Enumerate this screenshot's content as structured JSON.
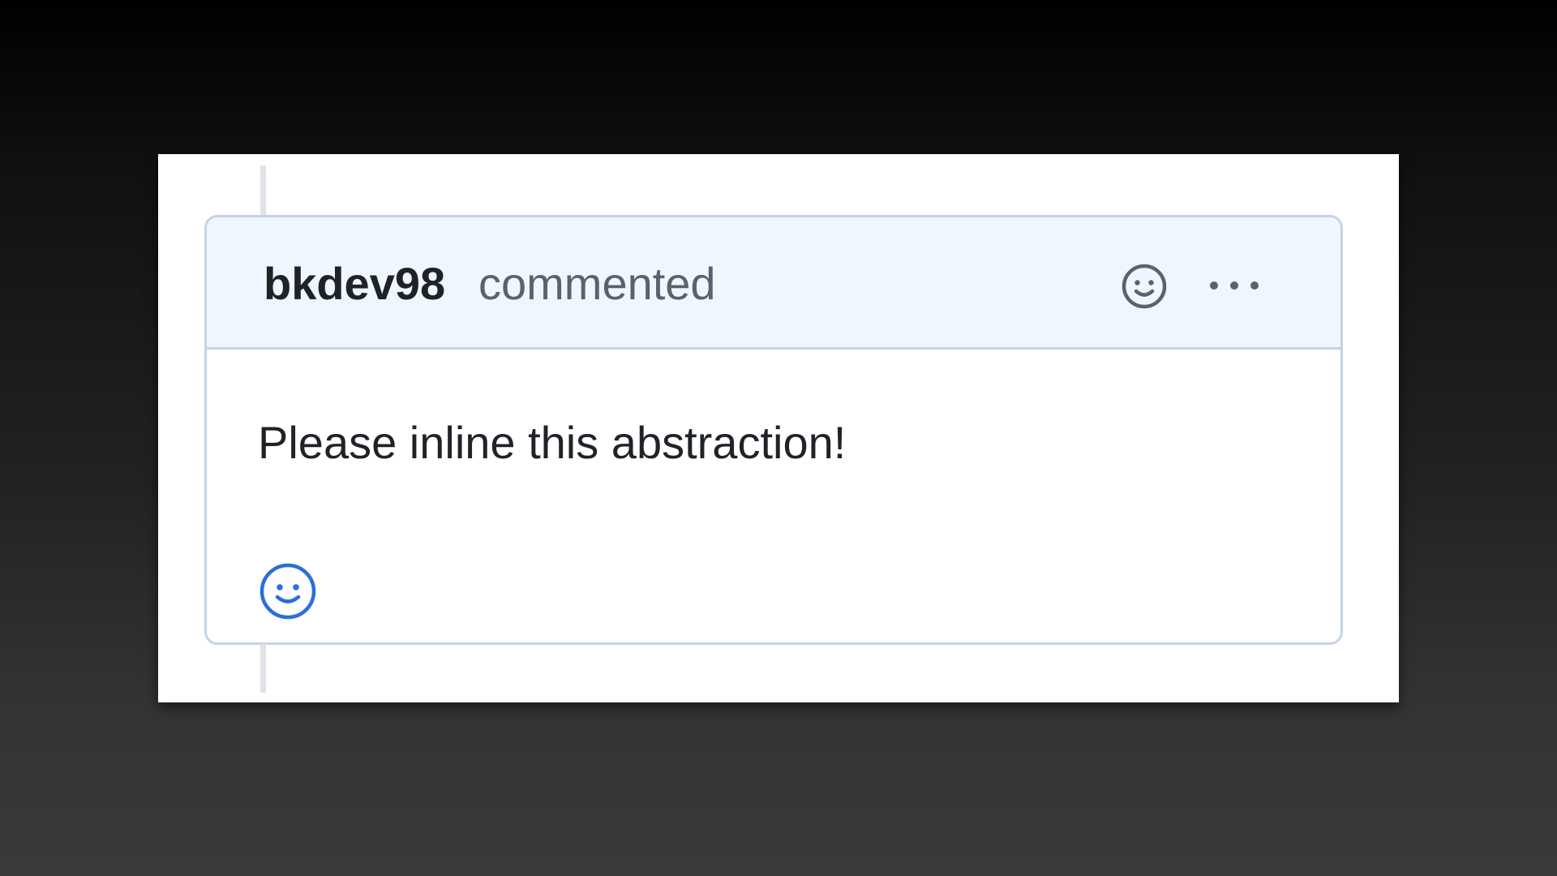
{
  "comment": {
    "author": "bkdev98",
    "action": "commented",
    "body": "Please inline this abstraction!"
  },
  "icons": {
    "header_reaction": "smiley-icon",
    "more_actions": "kebab-horizontal-icon",
    "footer_reaction": "smiley-icon"
  },
  "colors": {
    "header_background": "#eff6ff",
    "border": "#c5d3e6",
    "author_text": "#1f2328",
    "muted_text": "#59636e",
    "reaction_accent": "#2a6fdb"
  }
}
